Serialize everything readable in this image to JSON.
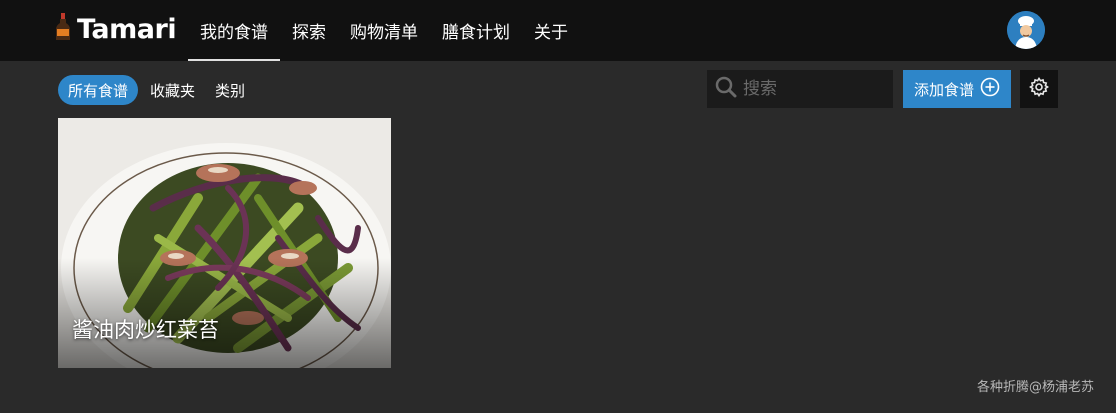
{
  "brand": {
    "name": "Tamari",
    "icon": "soy-sauce-bottle-icon"
  },
  "nav": {
    "items": [
      {
        "label": "我的食谱",
        "active": true
      },
      {
        "label": "探索",
        "active": false
      },
      {
        "label": "购物清单",
        "active": false
      },
      {
        "label": "膳食计划",
        "active": false
      },
      {
        "label": "关于",
        "active": false
      }
    ]
  },
  "user": {
    "avatar_icon": "chef-avatar-icon"
  },
  "filters": {
    "items": [
      {
        "label": "所有食谱",
        "active": true
      },
      {
        "label": "收藏夹",
        "active": false
      },
      {
        "label": "类别",
        "active": false
      }
    ]
  },
  "search": {
    "placeholder": "搜索",
    "value": "",
    "icon": "search-icon"
  },
  "toolbar": {
    "add_label": "添加食谱",
    "add_icon": "plus-circle-icon",
    "settings_icon": "gear-icon"
  },
  "recipes": [
    {
      "title": "酱油肉炒红菜苔"
    }
  ],
  "footer": {
    "credit": "各种折腾@杨浦老苏"
  },
  "colors": {
    "accent": "#2e86c9",
    "topbar": "#111111",
    "background": "#2a2a2a"
  }
}
